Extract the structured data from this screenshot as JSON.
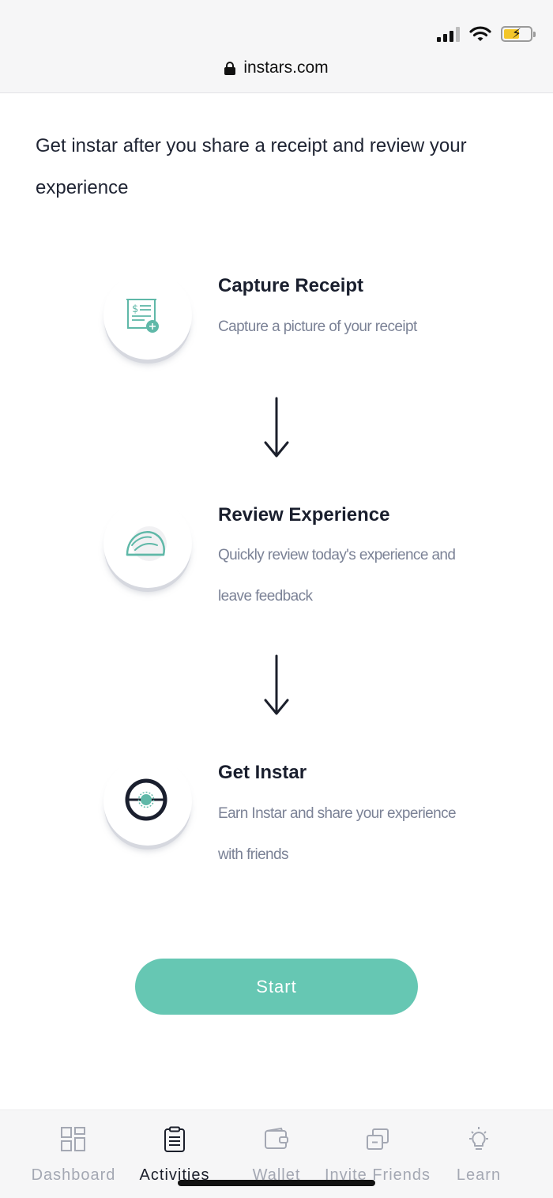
{
  "browser": {
    "url": "instars.com"
  },
  "intro": "Get instar after you share a receipt and review your experience",
  "steps": [
    {
      "title": "Capture Receipt",
      "desc": "Capture a picture of your receipt"
    },
    {
      "title": "Review Experience",
      "desc": "Quickly review today's experience and leave feedback"
    },
    {
      "title": "Get Instar",
      "desc": "Earn Instar and share your experience with friends"
    }
  ],
  "start_label": "Start",
  "nav": [
    {
      "label": "Dashboard",
      "icon": "grid-icon",
      "active": false
    },
    {
      "label": "Activities",
      "icon": "clipboard-icon",
      "active": true
    },
    {
      "label": "Wallet",
      "icon": "wallet-icon",
      "active": false
    },
    {
      "label": "Invite Friends",
      "icon": "invite-icon",
      "active": false
    },
    {
      "label": "Learn",
      "icon": "lightbulb-icon",
      "active": false
    }
  ],
  "colors": {
    "accent": "#66c7b3",
    "icon_teal": "#5fb8a8",
    "text_dark": "#1f2433",
    "text_muted": "#7b8296"
  }
}
